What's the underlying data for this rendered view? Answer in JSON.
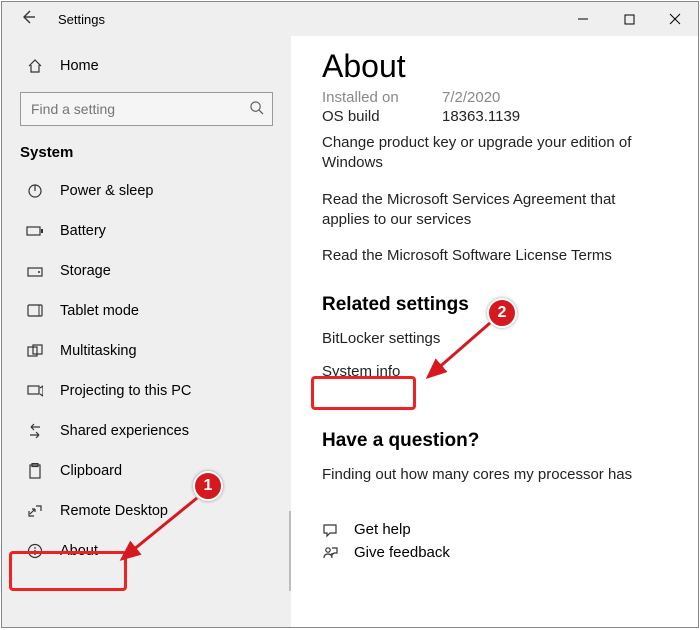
{
  "window": {
    "title": "Settings"
  },
  "sidebar": {
    "home_label": "Home",
    "search_placeholder": "Find a setting",
    "category": "System",
    "items": [
      {
        "label": "Power & sleep"
      },
      {
        "label": "Battery"
      },
      {
        "label": "Storage"
      },
      {
        "label": "Tablet mode"
      },
      {
        "label": "Multitasking"
      },
      {
        "label": "Projecting to this PC"
      },
      {
        "label": "Shared experiences"
      },
      {
        "label": "Clipboard"
      },
      {
        "label": "Remote Desktop"
      },
      {
        "label": "About"
      }
    ]
  },
  "content": {
    "title": "About",
    "installed_on_label": "Installed on",
    "installed_on_value": "7/2/2020",
    "os_build_label": "OS build",
    "os_build_value": "18363.1139",
    "change_key_text": "Change product key or upgrade your edition of Windows",
    "msa_text": "Read the Microsoft Services Agreement that applies to our services",
    "license_text": "Read the Microsoft Software License Terms",
    "related_heading": "Related settings",
    "related_items": [
      {
        "label": "BitLocker settings"
      },
      {
        "label": "System info"
      }
    ],
    "question_heading": "Have a question?",
    "question_item": "Finding out how many cores my processor has",
    "get_help": "Get help",
    "give_feedback": "Give feedback"
  },
  "annotation": {
    "badge1": "1",
    "badge2": "2"
  }
}
